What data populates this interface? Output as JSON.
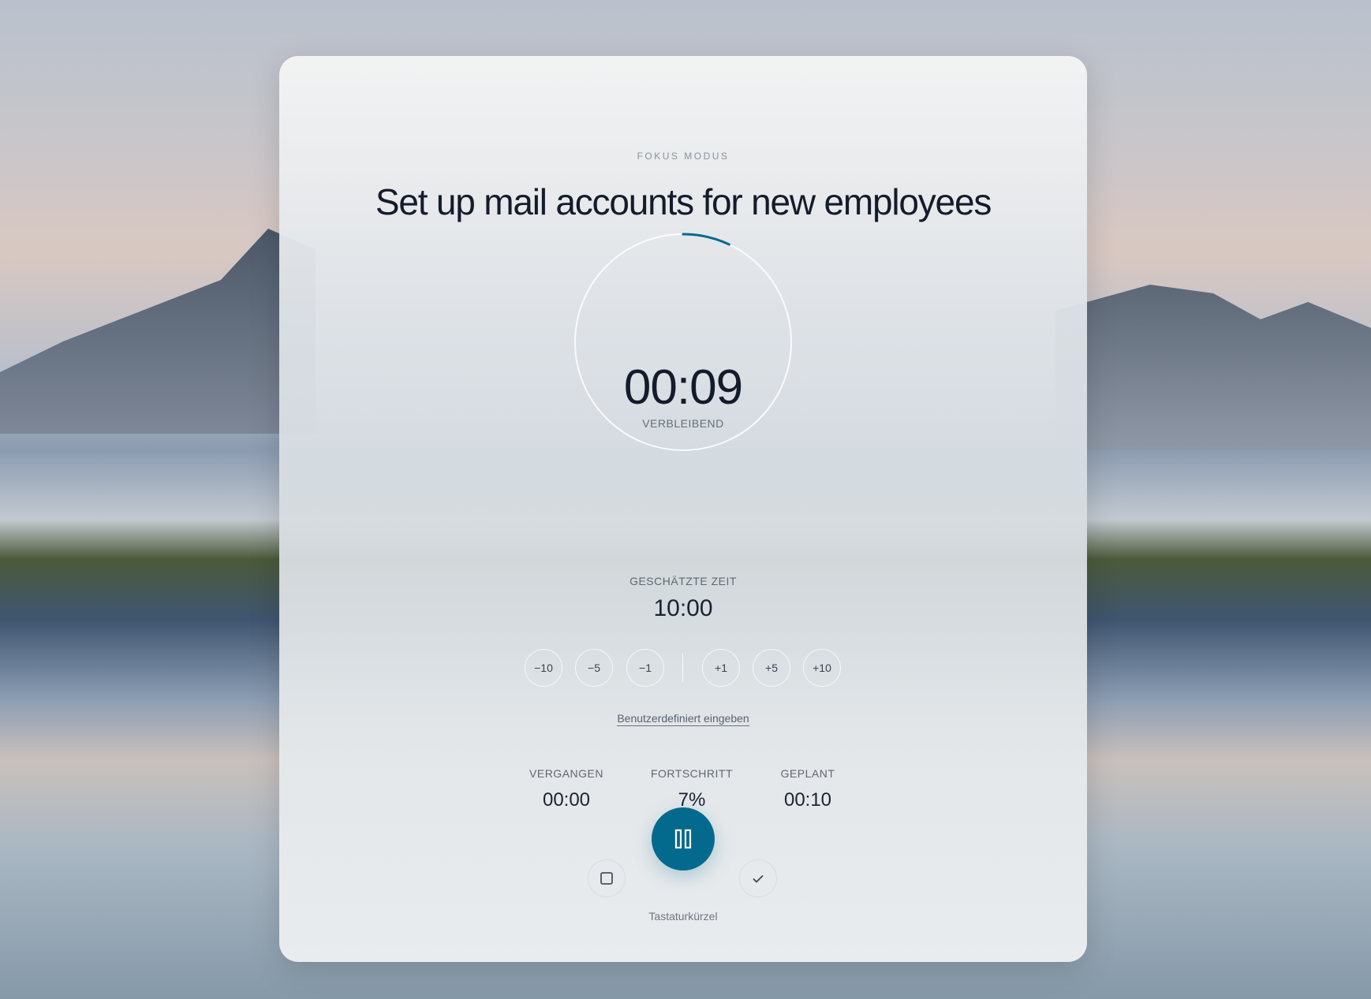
{
  "header": {
    "eyebrow": "FOKUS MODUS",
    "title": "Set up mail accounts for new employees"
  },
  "timer": {
    "remaining": "00:09",
    "remaining_label": "VERBLEIBEND",
    "progress_percent": 7,
    "accent": "#046a8d"
  },
  "estimate": {
    "label": "GESCHÄTZTE ZEIT",
    "value": "10:00"
  },
  "adjust": {
    "minus": [
      "−10",
      "−5",
      "−1"
    ],
    "plus": [
      "+1",
      "+5",
      "+10"
    ],
    "custom_link": "Benutzerdefiniert eingeben"
  },
  "stats": [
    {
      "label": "VERGANGEN",
      "value": "00:00"
    },
    {
      "label": "FORTSCHRITT",
      "value": "7%"
    },
    {
      "label": "GEPLANT",
      "value": "00:10"
    }
  ],
  "controls": {
    "stop_icon": "square-icon",
    "main_icon": "pause-icon",
    "complete_icon": "check-icon"
  },
  "footer": {
    "shortcuts_link": "Tastaturkürzel"
  }
}
